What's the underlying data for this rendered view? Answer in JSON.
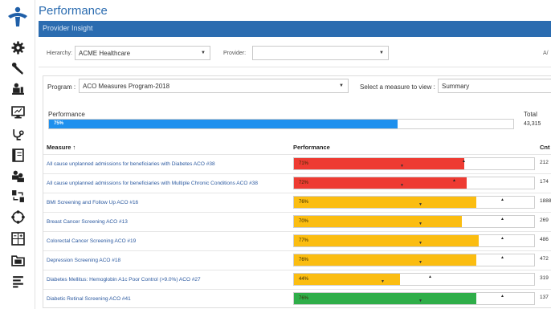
{
  "app": {
    "title": "Performance",
    "banner": "Provider Insight"
  },
  "filters": {
    "hierarchy_label": "Hierarchy:",
    "hierarchy_value": "ACME Healthcare",
    "provider_label": "Provider:",
    "provider_value": "",
    "corner_text": "A/"
  },
  "program": {
    "label": "Program :",
    "value": "ACO Measures Program-2018",
    "measure_view_label": "Select a measure to view :",
    "measure_view_value": "Summary"
  },
  "summary": {
    "performance_label": "Performance",
    "percent": 75,
    "percent_text": "75%",
    "total_label": "Total",
    "total_value": "43,315"
  },
  "table": {
    "headers": {
      "measure": "Measure ↑",
      "performance": "Performance",
      "count": "Cnt"
    },
    "rows": [
      {
        "measure": "All cause unplanned admissions for beneficiaries with Diabetes ACO #38",
        "percent": 71,
        "percent_text": "71%",
        "color": "#ee3b32",
        "count": "212",
        "down": 44,
        "up": 70
      },
      {
        "measure": "All cause unplanned admissions for beneficiaries with Multiple Chronic Conditions ACO #38",
        "percent": 72,
        "percent_text": "72%",
        "color": "#ee3b32",
        "count": "174",
        "down": 44,
        "up": 66
      },
      {
        "measure": "BMI Screening and Follow Up ACO #16",
        "percent": 76,
        "percent_text": "76%",
        "color": "#fbbd11",
        "count": "1888",
        "down": 52,
        "up": 86
      },
      {
        "measure": "Breast Cancer Screening ACO #13",
        "percent": 70,
        "percent_text": "70%",
        "color": "#fbbd11",
        "count": "269",
        "down": 52,
        "up": 86
      },
      {
        "measure": "Colorectal Cancer Screening ACO #19",
        "percent": 77,
        "percent_text": "77%",
        "color": "#fbbd11",
        "count": "486",
        "down": 52,
        "up": 86
      },
      {
        "measure": "Depression Screening ACO #18",
        "percent": 76,
        "percent_text": "76%",
        "color": "#fbbd11",
        "count": "472",
        "down": 52,
        "up": 86
      },
      {
        "measure": "Diabetes Mellitus: Hemoglobin A1c Poor Control (>9.0%) ACO #27",
        "percent": 44,
        "percent_text": "44%",
        "color": "#fbbd11",
        "count": "319",
        "down": 36,
        "up": 56
      },
      {
        "measure": "Diabetic Retinal Screening ACO #41",
        "percent": 76,
        "percent_text": "76%",
        "color": "#2fae49",
        "count": "137",
        "down": 52,
        "up": 86
      }
    ]
  },
  "icons": [
    "logo-icon",
    "gear-icon",
    "wrench-icon",
    "person-chart-icon",
    "monitor-icon",
    "stethoscope-icon",
    "book-icon",
    "users-icon",
    "transfer-icon",
    "network-icon",
    "calculator-icon",
    "folder-icon",
    "list-icon"
  ]
}
